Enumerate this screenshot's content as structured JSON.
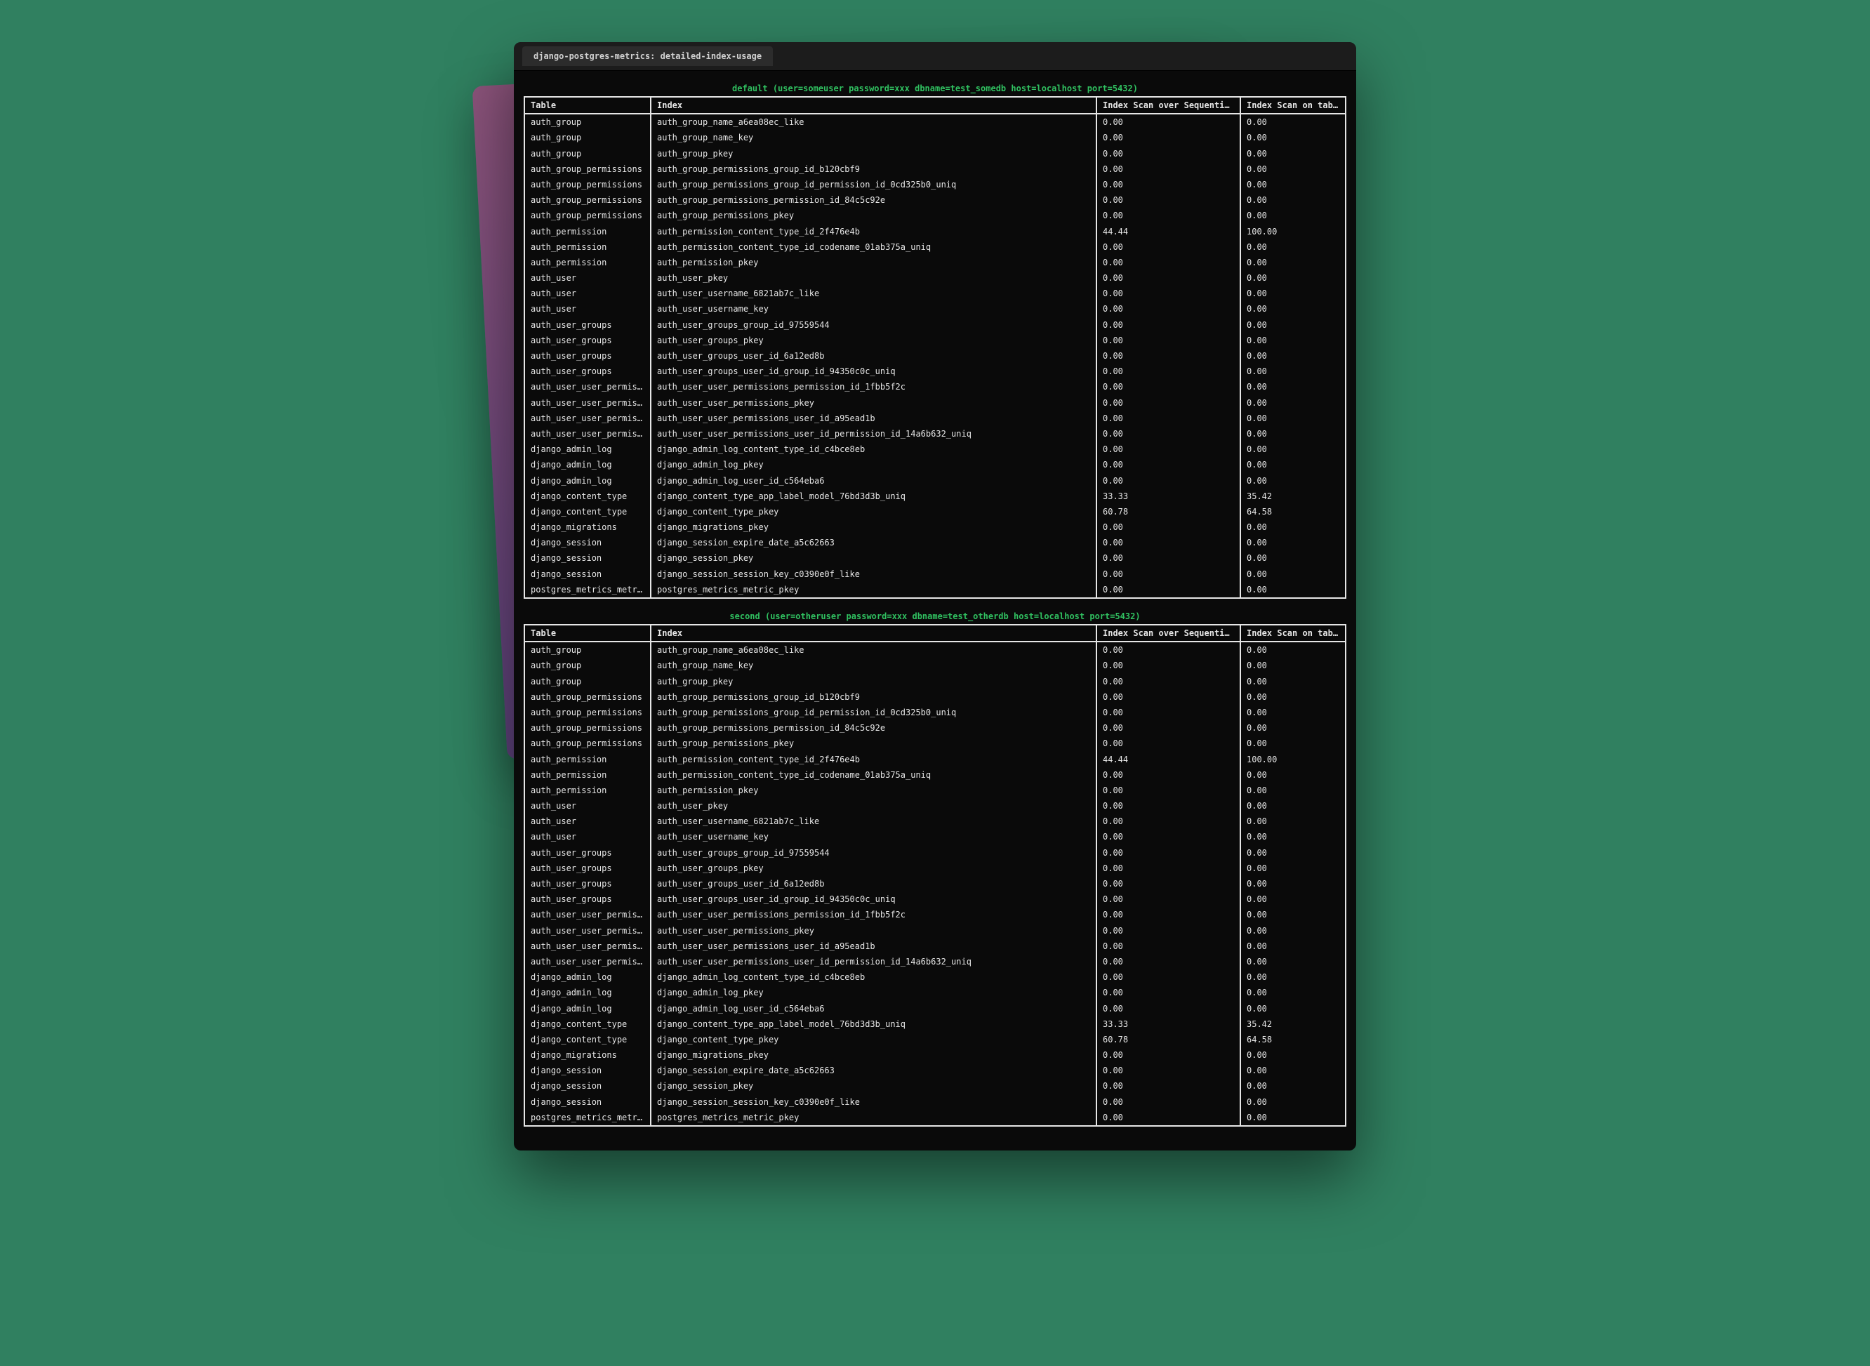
{
  "window": {
    "tab_title": "django-postgres-metrics: detailed-index-usage"
  },
  "headers": {
    "table": "Table",
    "index": "Index",
    "seq": "Index Scan over Sequential Scan",
    "on": "Index Scan on table"
  },
  "databases": [
    {
      "caption": "default (user=someuser password=xxx dbname=test_somedb host=localhost port=5432)",
      "rows": [
        {
          "table": "auth_group",
          "index": "auth_group_name_a6ea08ec_like",
          "seq": "0.00",
          "on": "0.00"
        },
        {
          "table": "auth_group",
          "index": "auth_group_name_key",
          "seq": "0.00",
          "on": "0.00"
        },
        {
          "table": "auth_group",
          "index": "auth_group_pkey",
          "seq": "0.00",
          "on": "0.00"
        },
        {
          "table": "auth_group_permissions",
          "index": "auth_group_permissions_group_id_b120cbf9",
          "seq": "0.00",
          "on": "0.00"
        },
        {
          "table": "auth_group_permissions",
          "index": "auth_group_permissions_group_id_permission_id_0cd325b0_uniq",
          "seq": "0.00",
          "on": "0.00"
        },
        {
          "table": "auth_group_permissions",
          "index": "auth_group_permissions_permission_id_84c5c92e",
          "seq": "0.00",
          "on": "0.00"
        },
        {
          "table": "auth_group_permissions",
          "index": "auth_group_permissions_pkey",
          "seq": "0.00",
          "on": "0.00"
        },
        {
          "table": "auth_permission",
          "index": "auth_permission_content_type_id_2f476e4b",
          "seq": "44.44",
          "on": "100.00"
        },
        {
          "table": "auth_permission",
          "index": "auth_permission_content_type_id_codename_01ab375a_uniq",
          "seq": "0.00",
          "on": "0.00"
        },
        {
          "table": "auth_permission",
          "index": "auth_permission_pkey",
          "seq": "0.00",
          "on": "0.00"
        },
        {
          "table": "auth_user",
          "index": "auth_user_pkey",
          "seq": "0.00",
          "on": "0.00"
        },
        {
          "table": "auth_user",
          "index": "auth_user_username_6821ab7c_like",
          "seq": "0.00",
          "on": "0.00"
        },
        {
          "table": "auth_user",
          "index": "auth_user_username_key",
          "seq": "0.00",
          "on": "0.00"
        },
        {
          "table": "auth_user_groups",
          "index": "auth_user_groups_group_id_97559544",
          "seq": "0.00",
          "on": "0.00"
        },
        {
          "table": "auth_user_groups",
          "index": "auth_user_groups_pkey",
          "seq": "0.00",
          "on": "0.00"
        },
        {
          "table": "auth_user_groups",
          "index": "auth_user_groups_user_id_6a12ed8b",
          "seq": "0.00",
          "on": "0.00"
        },
        {
          "table": "auth_user_groups",
          "index": "auth_user_groups_user_id_group_id_94350c0c_uniq",
          "seq": "0.00",
          "on": "0.00"
        },
        {
          "table": "auth_user_user_permissions",
          "index": "auth_user_user_permissions_permission_id_1fbb5f2c",
          "seq": "0.00",
          "on": "0.00"
        },
        {
          "table": "auth_user_user_permissions",
          "index": "auth_user_user_permissions_pkey",
          "seq": "0.00",
          "on": "0.00"
        },
        {
          "table": "auth_user_user_permissions",
          "index": "auth_user_user_permissions_user_id_a95ead1b",
          "seq": "0.00",
          "on": "0.00"
        },
        {
          "table": "auth_user_user_permissions",
          "index": "auth_user_user_permissions_user_id_permission_id_14a6b632_uniq",
          "seq": "0.00",
          "on": "0.00"
        },
        {
          "table": "django_admin_log",
          "index": "django_admin_log_content_type_id_c4bce8eb",
          "seq": "0.00",
          "on": "0.00"
        },
        {
          "table": "django_admin_log",
          "index": "django_admin_log_pkey",
          "seq": "0.00",
          "on": "0.00"
        },
        {
          "table": "django_admin_log",
          "index": "django_admin_log_user_id_c564eba6",
          "seq": "0.00",
          "on": "0.00"
        },
        {
          "table": "django_content_type",
          "index": "django_content_type_app_label_model_76bd3d3b_uniq",
          "seq": "33.33",
          "on": "35.42"
        },
        {
          "table": "django_content_type",
          "index": "django_content_type_pkey",
          "seq": "60.78",
          "on": "64.58"
        },
        {
          "table": "django_migrations",
          "index": "django_migrations_pkey",
          "seq": "0.00",
          "on": "0.00"
        },
        {
          "table": "django_session",
          "index": "django_session_expire_date_a5c62663",
          "seq": "0.00",
          "on": "0.00"
        },
        {
          "table": "django_session",
          "index": "django_session_pkey",
          "seq": "0.00",
          "on": "0.00"
        },
        {
          "table": "django_session",
          "index": "django_session_session_key_c0390e0f_like",
          "seq": "0.00",
          "on": "0.00"
        },
        {
          "table": "postgres_metrics_metric",
          "index": "postgres_metrics_metric_pkey",
          "seq": "0.00",
          "on": "0.00"
        }
      ]
    },
    {
      "caption": "second (user=otheruser password=xxx dbname=test_otherdb host=localhost port=5432)",
      "rows": [
        {
          "table": "auth_group",
          "index": "auth_group_name_a6ea08ec_like",
          "seq": "0.00",
          "on": "0.00"
        },
        {
          "table": "auth_group",
          "index": "auth_group_name_key",
          "seq": "0.00",
          "on": "0.00"
        },
        {
          "table": "auth_group",
          "index": "auth_group_pkey",
          "seq": "0.00",
          "on": "0.00"
        },
        {
          "table": "auth_group_permissions",
          "index": "auth_group_permissions_group_id_b120cbf9",
          "seq": "0.00",
          "on": "0.00"
        },
        {
          "table": "auth_group_permissions",
          "index": "auth_group_permissions_group_id_permission_id_0cd325b0_uniq",
          "seq": "0.00",
          "on": "0.00"
        },
        {
          "table": "auth_group_permissions",
          "index": "auth_group_permissions_permission_id_84c5c92e",
          "seq": "0.00",
          "on": "0.00"
        },
        {
          "table": "auth_group_permissions",
          "index": "auth_group_permissions_pkey",
          "seq": "0.00",
          "on": "0.00"
        },
        {
          "table": "auth_permission",
          "index": "auth_permission_content_type_id_2f476e4b",
          "seq": "44.44",
          "on": "100.00"
        },
        {
          "table": "auth_permission",
          "index": "auth_permission_content_type_id_codename_01ab375a_uniq",
          "seq": "0.00",
          "on": "0.00"
        },
        {
          "table": "auth_permission",
          "index": "auth_permission_pkey",
          "seq": "0.00",
          "on": "0.00"
        },
        {
          "table": "auth_user",
          "index": "auth_user_pkey",
          "seq": "0.00",
          "on": "0.00"
        },
        {
          "table": "auth_user",
          "index": "auth_user_username_6821ab7c_like",
          "seq": "0.00",
          "on": "0.00"
        },
        {
          "table": "auth_user",
          "index": "auth_user_username_key",
          "seq": "0.00",
          "on": "0.00"
        },
        {
          "table": "auth_user_groups",
          "index": "auth_user_groups_group_id_97559544",
          "seq": "0.00",
          "on": "0.00"
        },
        {
          "table": "auth_user_groups",
          "index": "auth_user_groups_pkey",
          "seq": "0.00",
          "on": "0.00"
        },
        {
          "table": "auth_user_groups",
          "index": "auth_user_groups_user_id_6a12ed8b",
          "seq": "0.00",
          "on": "0.00"
        },
        {
          "table": "auth_user_groups",
          "index": "auth_user_groups_user_id_group_id_94350c0c_uniq",
          "seq": "0.00",
          "on": "0.00"
        },
        {
          "table": "auth_user_user_permissions",
          "index": "auth_user_user_permissions_permission_id_1fbb5f2c",
          "seq": "0.00",
          "on": "0.00"
        },
        {
          "table": "auth_user_user_permissions",
          "index": "auth_user_user_permissions_pkey",
          "seq": "0.00",
          "on": "0.00"
        },
        {
          "table": "auth_user_user_permissions",
          "index": "auth_user_user_permissions_user_id_a95ead1b",
          "seq": "0.00",
          "on": "0.00"
        },
        {
          "table": "auth_user_user_permissions",
          "index": "auth_user_user_permissions_user_id_permission_id_14a6b632_uniq",
          "seq": "0.00",
          "on": "0.00"
        },
        {
          "table": "django_admin_log",
          "index": "django_admin_log_content_type_id_c4bce8eb",
          "seq": "0.00",
          "on": "0.00"
        },
        {
          "table": "django_admin_log",
          "index": "django_admin_log_pkey",
          "seq": "0.00",
          "on": "0.00"
        },
        {
          "table": "django_admin_log",
          "index": "django_admin_log_user_id_c564eba6",
          "seq": "0.00",
          "on": "0.00"
        },
        {
          "table": "django_content_type",
          "index": "django_content_type_app_label_model_76bd3d3b_uniq",
          "seq": "33.33",
          "on": "35.42"
        },
        {
          "table": "django_content_type",
          "index": "django_content_type_pkey",
          "seq": "60.78",
          "on": "64.58"
        },
        {
          "table": "django_migrations",
          "index": "django_migrations_pkey",
          "seq": "0.00",
          "on": "0.00"
        },
        {
          "table": "django_session",
          "index": "django_session_expire_date_a5c62663",
          "seq": "0.00",
          "on": "0.00"
        },
        {
          "table": "django_session",
          "index": "django_session_pkey",
          "seq": "0.00",
          "on": "0.00"
        },
        {
          "table": "django_session",
          "index": "django_session_session_key_c0390e0f_like",
          "seq": "0.00",
          "on": "0.00"
        },
        {
          "table": "postgres_metrics_metric",
          "index": "postgres_metrics_metric_pkey",
          "seq": "0.00",
          "on": "0.00"
        }
      ]
    }
  ]
}
